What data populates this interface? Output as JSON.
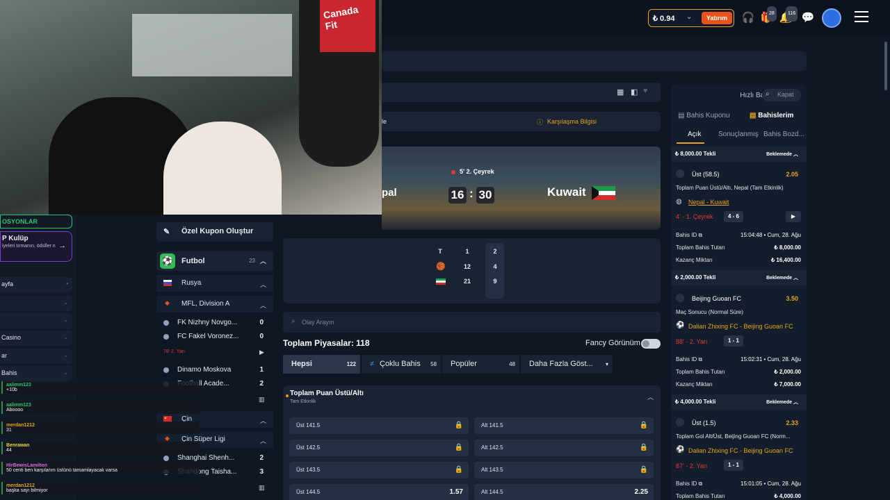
{
  "header": {
    "balance": "₺ 0.94",
    "deposit_label": "Yatırım",
    "gift_badge": "28",
    "notif_badge": "116"
  },
  "webcam": {
    "bag_text": "Canada Fit"
  },
  "left_menu": {
    "promo": "OSYONLAR",
    "vip_title": "P Kulüp",
    "vip_sub": "iyeleri tırmanın, ödüller n",
    "items": [
      "ayfa",
      "",
      "",
      "Casino",
      "ar",
      "Bahis"
    ]
  },
  "chat": [
    {
      "user": "aalimm123",
      "text": "+10b",
      "color": "#2fc46b"
    },
    {
      "user": "aalimm123",
      "text": "Aboooo",
      "color": "#2fc46b"
    },
    {
      "user": "merdan1212",
      "text": "31",
      "color": "#e7a41f"
    },
    {
      "user": "Benrawan",
      "text": "44",
      "color": "#e7d93a"
    },
    {
      "user": "HirBewisLamilton",
      "text": "50 centi ben karşılarım üstünü tamamlayacak varsa",
      "color": "#d16be0"
    },
    {
      "user": "merdan1212",
      "text": "başka sayı bilmiyor",
      "color": "#e7a41f"
    }
  ],
  "sports": {
    "custom_coupon": "Özel Kupon Oluştur",
    "football": {
      "label": "Futbol",
      "count": "23"
    },
    "russia": "Rusya",
    "league1": "MFL, Division A",
    "matches1": [
      {
        "team": "FK Nizhny Novgo...",
        "score": "0"
      },
      {
        "team": "FC Fakel Voronez...",
        "score": "0"
      }
    ],
    "live1": "78' 2. Yarı",
    "matches2": [
      {
        "team": "Dinamo Moskova",
        "score": "1"
      },
      {
        "team": "Football Acade...",
        "score": "2"
      }
    ],
    "china": "Çin",
    "league2": "Çin Süper Ligi",
    "matches3": [
      {
        "team": "Shanghai Shenh...",
        "score": "2"
      },
      {
        "team": "Shandong Taisha...",
        "score": "3"
      }
    ]
  },
  "match": {
    "info_left": "le",
    "info_label": "Karşılaşma Bilgisi",
    "period": "5' 2. Çeyrek",
    "home": "pal",
    "away": "Kuwait",
    "home_score": "16",
    "away_score": "30",
    "colon": ":",
    "box": {
      "headers": [
        "T",
        "1",
        "2"
      ],
      "home": [
        "12",
        "4"
      ],
      "away": [
        "21",
        "9"
      ]
    }
  },
  "markets": {
    "search_placeholder": "Olay Arayın",
    "total_label": "Toplam Piyasalar:",
    "total_count": "118",
    "fancy_label": "Fancy Görünüm",
    "tabs": [
      {
        "label": "Hepsi",
        "count": "122"
      },
      {
        "label": "Çoklu Bahis",
        "count": "58"
      },
      {
        "label": "Popüler",
        "count": "48"
      },
      {
        "label": "Daha Fazla Göst...",
        "count": ""
      }
    ],
    "market_title": "Toplam Puan Üstü/Altı",
    "market_sub": "Tam Etkinlik",
    "odds": [
      {
        "over": "Üst 141.5",
        "under": "Alt 141.5",
        "ov": "",
        "uv": ""
      },
      {
        "over": "Üst 142.5",
        "under": "Alt 142.5",
        "ov": "",
        "uv": ""
      },
      {
        "over": "Üst 143.5",
        "under": "Alt 143.5",
        "ov": "",
        "uv": ""
      },
      {
        "over": "Üst 144.5",
        "under": "Alt 144.5",
        "ov": "1.57",
        "uv": "2.25"
      }
    ]
  },
  "betslip": {
    "quick_bet": "Hızlı Bahis",
    "close": "Kapat",
    "tab_coupon": "Bahis Kuponu",
    "tab_mybets": "Bahislerim",
    "sub_open": "Açık",
    "sub_settled": "Sonuçlanmış",
    "sub_bonus": "Bahis Bozd...",
    "bets": [
      {
        "head": "₺ 8,000.00 Tekli",
        "status": "Beklemede",
        "selection": "Üst (58.5)",
        "odd": "2.05",
        "market": "Toplam Puan Üstü/Altı, Nepal (Tam Etkinlik)",
        "match": "Nepal - Kuwait",
        "live": "4' - 1. Çeyrek",
        "score": "4 - 6",
        "bet_id_label": "Bahis ID",
        "bet_id_value": "15:04:48 • Cum, 28. Ağu",
        "stake_label": "Toplam Bahis Tutarı",
        "stake": "₺ 8,000.00",
        "win_label": "Kazanç Miktarı",
        "win": "₺ 16,400.00"
      },
      {
        "head": "₺ 2,000.00 Tekli",
        "status": "Beklemede",
        "selection": "Beijing Guoan FC",
        "odd": "3.50",
        "market": "Maç Sonucu (Normal Süre)",
        "match": "Dalian Zhixing FC - Beijing Guoan FC",
        "live": "88' - 2. Yarı",
        "score": "1 - 1",
        "bet_id_label": "Bahis ID",
        "bet_id_value": "15:02:31 • Cum, 28. Ağu",
        "stake_label": "Toplam Bahis Tutarı",
        "stake": "₺ 2,000.00",
        "win_label": "Kazanç Miktarı",
        "win": "₺ 7,000.00"
      },
      {
        "head": "₺ 4,000.00 Tekli",
        "status": "Beklemede",
        "selection": "Üst (1.5)",
        "odd": "2.33",
        "market": "Toplam Gol Alt/Üst, Beijing Guoan FC (Norm...",
        "match": "Dalian Zhixing FC - Beijing Guoan FC",
        "live": "87' - 2. Yarı",
        "score": "1 - 1",
        "bet_id_label": "Bahis ID",
        "bet_id_value": "15:01:05 • Cum, 28. Ağu",
        "stake_label": "Toplam Bahis Tutarı",
        "stake": "₺ 4,000.00"
      }
    ]
  },
  "colors": {
    "accent": "#e7a41f",
    "deposit": "#e8531c",
    "live": "#e53a3a",
    "football": "#2fbd57"
  }
}
